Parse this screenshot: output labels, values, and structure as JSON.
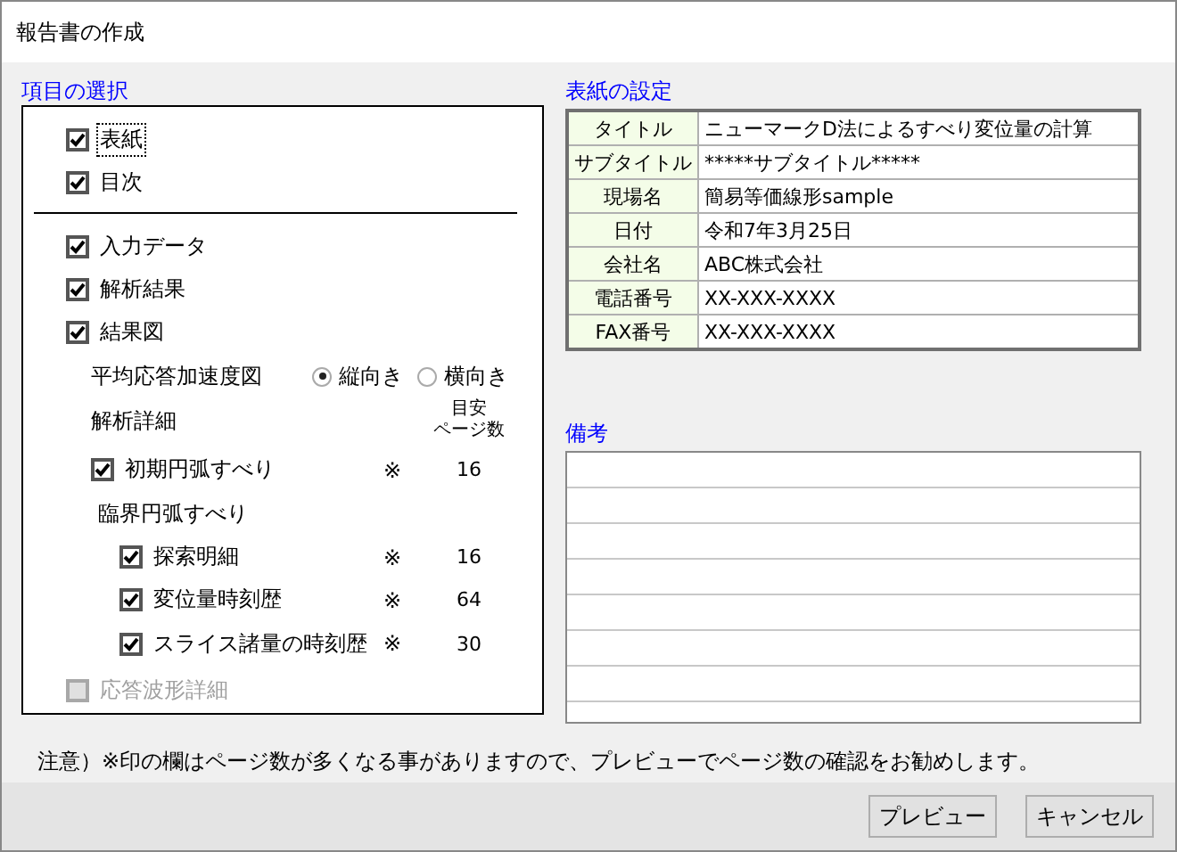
{
  "window": {
    "title": "報告書の作成"
  },
  "items": {
    "title": "項目の選択",
    "top": [
      {
        "label": "表紙",
        "checked": true,
        "focused": true
      },
      {
        "label": "目次",
        "checked": true,
        "focused": false
      }
    ],
    "main": [
      {
        "label": "入力データ",
        "checked": true
      },
      {
        "label": "解析結果",
        "checked": true
      },
      {
        "label": "結果図",
        "checked": true
      }
    ],
    "orientation": {
      "label": "平均応答加速度図",
      "options": [
        {
          "label": "縦向き",
          "selected": true
        },
        {
          "label": "横向き",
          "selected": false
        }
      ]
    },
    "details": {
      "label": "解析詳細",
      "pages_header": [
        "目安",
        "ページ数"
      ],
      "rows": [
        {
          "kind": "check",
          "label": "初期円弧すべり",
          "checked": true,
          "mark": "※",
          "pages": "16"
        },
        {
          "kind": "heading",
          "label": "臨界円弧すべり",
          "children": [
            {
              "kind": "check",
              "label": "探索明細",
              "checked": true,
              "mark": "※",
              "pages": "16"
            },
            {
              "kind": "check",
              "label": "変位量時刻歴",
              "checked": true,
              "mark": "※",
              "pages": "64"
            },
            {
              "kind": "check",
              "label": "スライス諸量の時刻歴",
              "checked": true,
              "mark": "※",
              "pages": "30"
            }
          ]
        }
      ]
    },
    "extra": {
      "label": "応答波形詳細",
      "checked": false,
      "disabled": true
    }
  },
  "cover": {
    "title": "表紙の設定",
    "rows": [
      {
        "label": "タイトル",
        "value": "ニューマークD法によるすべり変位量の計算"
      },
      {
        "label": "サブタイトル",
        "value": "*****サブタイトル*****"
      },
      {
        "label": "現場名",
        "value": "簡易等価線形sample"
      },
      {
        "label": "日付",
        "value": "令和7年3月25日"
      },
      {
        "label": "会社名",
        "value": "ABC株式会社"
      },
      {
        "label": "電話番号",
        "value": "XX-XXX-XXXX"
      },
      {
        "label": "FAX番号",
        "value": "XX-XXX-XXXX"
      }
    ]
  },
  "remarks": {
    "title": "備考"
  },
  "note": "注意）※印の欄はページ数が多くなる事がありますので、プレビューでページ数の確認をお勧めします。",
  "buttons": [
    "プレビュー",
    "キャンセル"
  ]
}
